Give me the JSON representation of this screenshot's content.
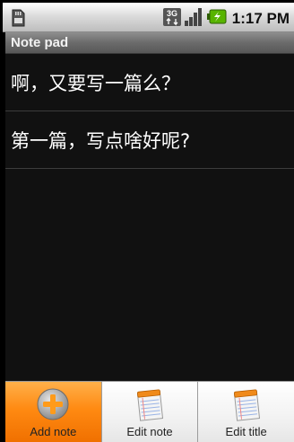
{
  "status_bar": {
    "network_label": "3G",
    "time": "1:17 PM",
    "icons": [
      "sd-card-icon",
      "3g-icon",
      "signal-icon",
      "battery-charging-icon"
    ]
  },
  "title_bar": {
    "title": "Note pad"
  },
  "notes": [
    {
      "text": "啊，又要写一篇么？"
    },
    {
      "text": "第一篇，写点啥好呢?"
    }
  ],
  "option_menu": {
    "items": [
      {
        "label": "Add note",
        "icon": "plus-icon",
        "selected": true
      },
      {
        "label": "Edit note",
        "icon": "notepad-icon",
        "selected": false
      },
      {
        "label": "Edit title",
        "icon": "notepad-icon",
        "selected": false
      }
    ]
  },
  "colors": {
    "menu_selected": "#ff8a12",
    "list_background": "#111111",
    "battery_green": "#58b400"
  }
}
